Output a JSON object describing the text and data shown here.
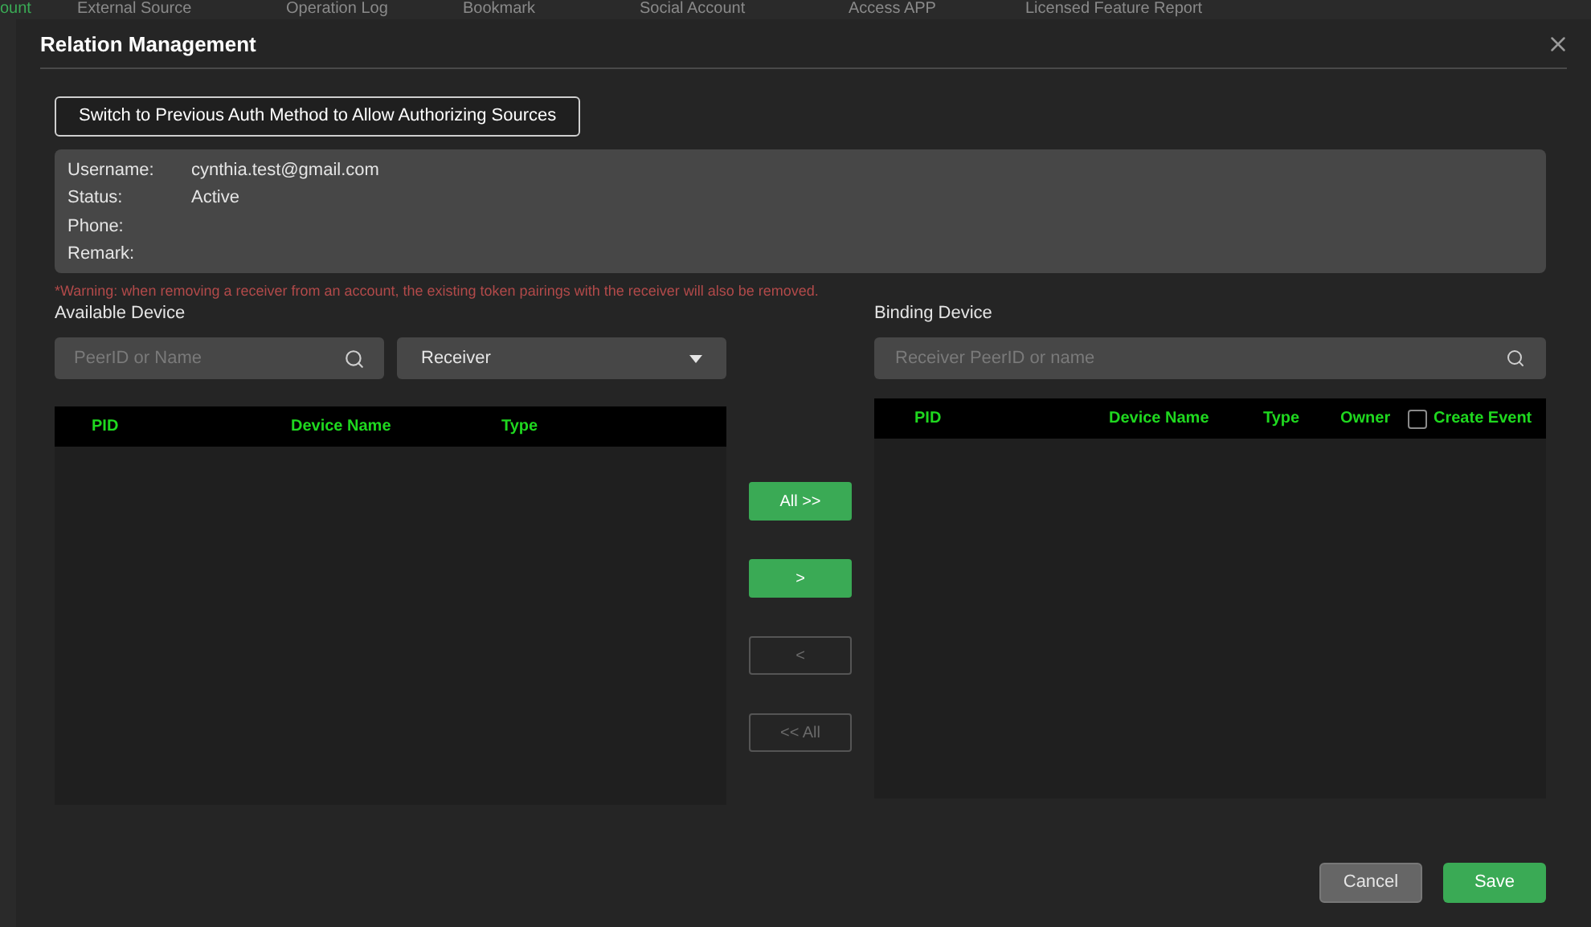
{
  "background_tabs": [
    {
      "label": "ount",
      "selected": true
    },
    {
      "label": "External Source",
      "selected": false
    },
    {
      "label": "Operation Log",
      "selected": false
    },
    {
      "label": "Bookmark",
      "selected": false
    },
    {
      "label": "Social Account",
      "selected": false
    },
    {
      "label": "Access APP",
      "selected": false
    },
    {
      "label": "Licensed Feature Report",
      "selected": false
    }
  ],
  "dialog": {
    "title": "Relation Management",
    "switch_button": "Switch to Previous Auth Method to Allow Authorizing Sources",
    "info": [
      {
        "label": "Username:",
        "value": "cynthia.test@gmail.com"
      },
      {
        "label": "Status:",
        "value": "Active"
      },
      {
        "label": "Phone:"
      },
      {
        "label": "Remark:"
      }
    ],
    "warning": "*Warning: when removing a receiver from an account, the existing token pairings with the receiver will also be removed.",
    "available": {
      "title": "Available Device",
      "search": {
        "placeholder": "PeerID or Name"
      },
      "type_select": "Receiver",
      "columns": [
        "PID",
        "Device Name",
        "Type"
      ]
    },
    "transfer_buttons": [
      {
        "label": "All >>",
        "disabled": false
      },
      {
        "label": ">",
        "disabled": false
      },
      {
        "label": "<",
        "disabled": true
      },
      {
        "label": "<< All",
        "disabled": true
      }
    ],
    "binding": {
      "title": "Binding Device",
      "search": {
        "placeholder": "Receiver PeerID or name"
      },
      "columns": [
        "PID",
        "Device Name",
        "Type",
        "Owner"
      ],
      "create_event": {
        "label": "Create Event",
        "checked": false
      }
    },
    "footer_buttons": [
      {
        "label": "Cancel",
        "kind": "secondary"
      },
      {
        "label": "Save",
        "kind": "primary"
      }
    ]
  }
}
